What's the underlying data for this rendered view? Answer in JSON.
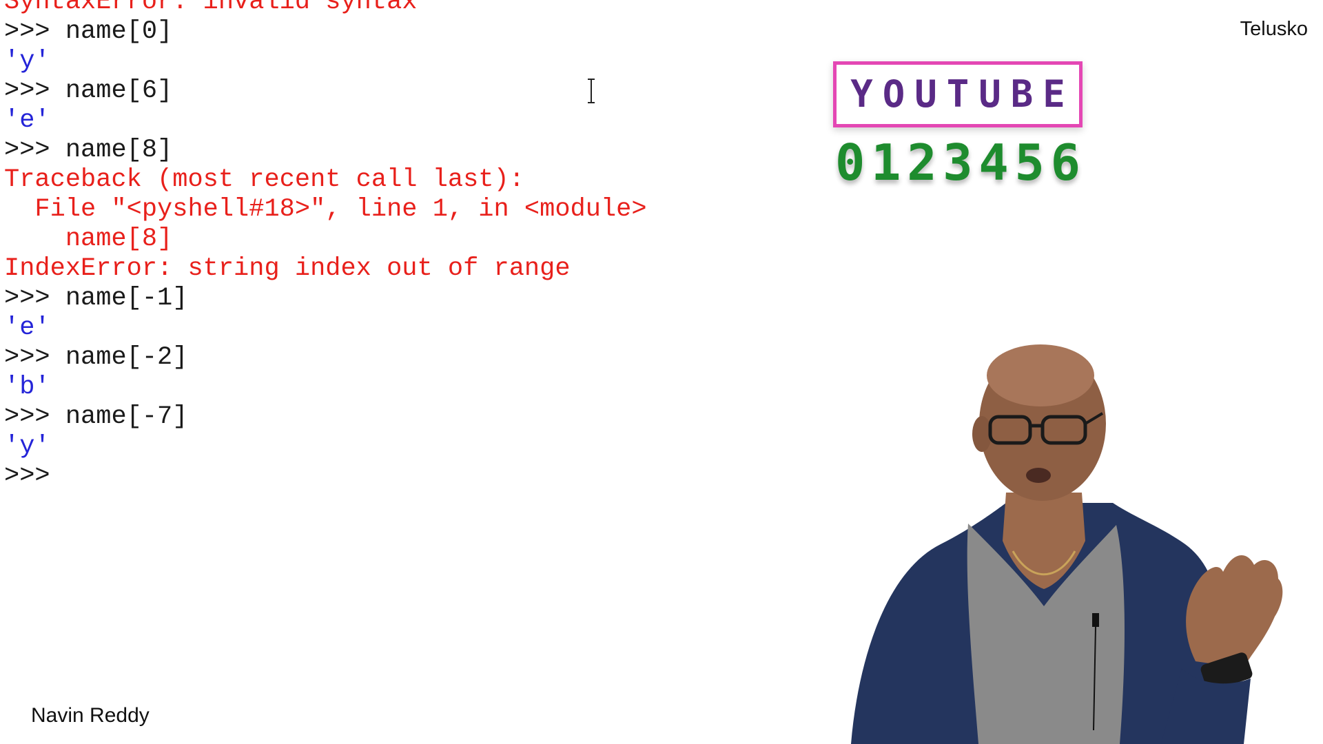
{
  "shell": {
    "lines": [
      {
        "type": "err",
        "text": "SyntaxError: invalid syntax"
      },
      {
        "type": "in",
        "prompt": ">>> ",
        "text": "name[0]"
      },
      {
        "type": "out",
        "text": "'y'"
      },
      {
        "type": "in",
        "prompt": ">>> ",
        "text": "name[6]"
      },
      {
        "type": "out",
        "text": "'e'"
      },
      {
        "type": "in",
        "prompt": ">>> ",
        "text": "name[8]"
      },
      {
        "type": "err",
        "text": "Traceback (most recent call last):"
      },
      {
        "type": "err",
        "text": "  File \"<pyshell#18>\", line 1, in <module>"
      },
      {
        "type": "err",
        "text": "    name[8]"
      },
      {
        "type": "err",
        "text": "IndexError: string index out of range"
      },
      {
        "type": "in",
        "prompt": ">>> ",
        "text": "name[-1]"
      },
      {
        "type": "out",
        "text": "'e'"
      },
      {
        "type": "in",
        "prompt": ">>> ",
        "text": "name[-2]"
      },
      {
        "type": "out",
        "text": "'b'"
      },
      {
        "type": "in",
        "prompt": ">>> ",
        "text": "name[-7]"
      },
      {
        "type": "out",
        "text": "'y'"
      },
      {
        "type": "in",
        "prompt": ">>> ",
        "text": ""
      }
    ]
  },
  "overlay": {
    "word": "YOUTUBE",
    "letters": [
      "Y",
      "O",
      "U",
      "T",
      "U",
      "B",
      "E"
    ],
    "indices": [
      "0",
      "1",
      "2",
      "3",
      "4",
      "5",
      "6"
    ]
  },
  "brand": "Telusko",
  "presenter": "Navin Reddy",
  "colors": {
    "prompt": "#1a1a1a",
    "output": "#2424d8",
    "error": "#e8201b",
    "box_border": "#e447b4",
    "letters": "#5a2a86",
    "digits": "#1e8c2e"
  }
}
